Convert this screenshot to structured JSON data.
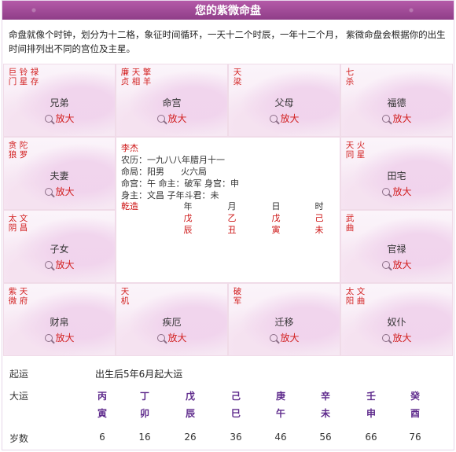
{
  "title": "您的紫微命盘",
  "intro": "命盘就像个时钟，划分为十二格，象征时间循环，一天十二个时辰，一年十二个月， 紫微命盘会根据你的出生时间排列出不同的宫位及主星。",
  "zoom_label": "放大",
  "palaces": [
    {
      "name": "兄弟",
      "stars": [
        "巨门",
        "铃星",
        "禄存"
      ]
    },
    {
      "name": "命宫",
      "stars": [
        "廉贞",
        "天相",
        "擎羊"
      ]
    },
    {
      "name": "父母",
      "stars": [
        "天梁"
      ]
    },
    {
      "name": "福德",
      "stars": [
        "七杀"
      ]
    },
    {
      "name": "夫妻",
      "stars": [
        "贪狼",
        "陀罗"
      ]
    },
    {
      "name": "田宅",
      "stars": [
        "天同",
        "火星"
      ]
    },
    {
      "name": "子女",
      "stars": [
        "太阴",
        "文昌"
      ]
    },
    {
      "name": "官禄",
      "stars": [
        "武曲"
      ]
    },
    {
      "name": "财帛",
      "stars": [
        "紫微",
        "天府"
      ]
    },
    {
      "name": "疾厄",
      "stars": [
        "天机"
      ]
    },
    {
      "name": "迁移",
      "stars": [
        "破军"
      ]
    },
    {
      "name": "奴仆",
      "stars": [
        "太阳",
        "文曲"
      ]
    }
  ],
  "center": {
    "name": "李杰",
    "lunar": "农历：一九八八年腊月十一",
    "ming_ju": "命局：阳男      火六局",
    "ming_gong": "命宫：午 命主：破军 身宫：申",
    "shen_zhu": "身主：文昌 子年斗君：未",
    "bazi_label": "乾造",
    "pillars": [
      {
        "head": "年",
        "stem": "戊",
        "branch": "辰"
      },
      {
        "head": "月",
        "stem": "乙",
        "branch": "丑"
      },
      {
        "head": "日",
        "stem": "戊",
        "branch": "寅"
      },
      {
        "head": "时",
        "stem": "己",
        "branch": "未"
      }
    ]
  },
  "bottom": {
    "qiyun_label": "起运",
    "qiyun_value": "出生后5年6月起大运",
    "dayun_label": "大运",
    "age_label": "岁数",
    "dayun": [
      {
        "stem": "丙",
        "branch": "寅",
        "age": "6"
      },
      {
        "stem": "丁",
        "branch": "卯",
        "age": "16"
      },
      {
        "stem": "戊",
        "branch": "辰",
        "age": "26"
      },
      {
        "stem": "己",
        "branch": "巳",
        "age": "36"
      },
      {
        "stem": "庚",
        "branch": "午",
        "age": "46"
      },
      {
        "stem": "辛",
        "branch": "未",
        "age": "56"
      },
      {
        "stem": "壬",
        "branch": "申",
        "age": "66"
      },
      {
        "stem": "癸",
        "branch": "酉",
        "age": "76"
      }
    ]
  }
}
